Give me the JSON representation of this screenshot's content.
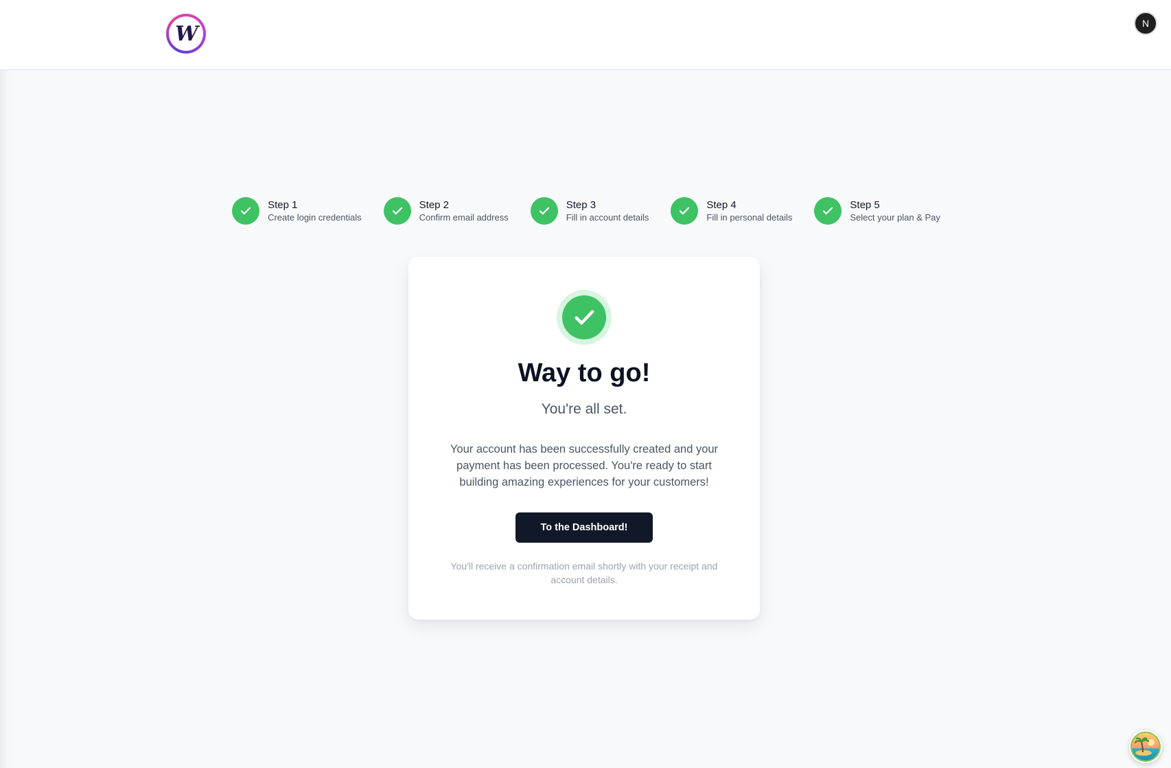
{
  "header": {
    "logo_letter": "W",
    "user_initial": "N"
  },
  "steps": [
    {
      "title": "Step 1",
      "description": "Create login credentials",
      "status": "complete"
    },
    {
      "title": "Step 2",
      "description": "Confirm email address",
      "status": "complete"
    },
    {
      "title": "Step 3",
      "description": "Fill in account details",
      "status": "complete"
    },
    {
      "title": "Step 4",
      "description": "Fill in personal details",
      "status": "complete"
    },
    {
      "title": "Step 5",
      "description": "Select your plan & Pay",
      "status": "complete"
    }
  ],
  "card": {
    "title": "Way to go!",
    "subtitle": "You're all set.",
    "body": "Your account has been successfully created and your payment has been processed. You're ready to start building amazing experiences for your customers!",
    "button_label": "To the Dashboard!",
    "footnote": "You'll receive a confirmation email shortly with your receipt and account details."
  },
  "icons": {
    "step_complete": "check-icon",
    "success": "check-icon",
    "assistant": "island-icon"
  },
  "colors": {
    "success_green": "#3ec264",
    "success_green_light": "#d7f5df",
    "button_dark": "#111827",
    "page_background": "#f8f9fa"
  }
}
